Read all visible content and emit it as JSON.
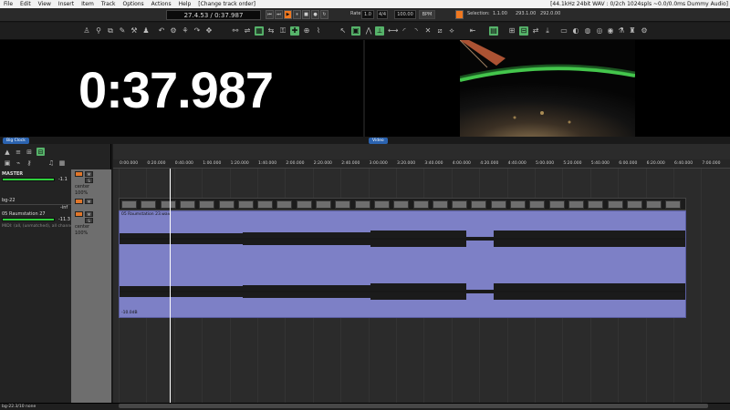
{
  "menubar": {
    "items": [
      "File",
      "Edit",
      "View",
      "Insert",
      "Item",
      "Track",
      "Options",
      "Actions",
      "Help",
      "[Change track order]"
    ],
    "status": "[44.1kHz 24bit WAV : 0/2ch 1024spls ~0.0/0.0ms Dummy Audio]"
  },
  "transport": {
    "time": "27.4.53 / 0:37.987",
    "rate_label": "Rate:",
    "rate_value": "1.0",
    "timesig": "4/4",
    "bpm_value": "100.00",
    "bpm_label": "BPM",
    "selection_label": "Selection:",
    "sel_start": "1.1.00",
    "sel_end": "293.1.00",
    "sel_len": "292.0.00"
  },
  "panels": {
    "big_clock_time": "0:37.987",
    "big_clock_tab": "Big Clock",
    "video_tab": "Video"
  },
  "tracks": {
    "master": {
      "name": "MASTER",
      "meter": "-1.1",
      "pan": "center",
      "vol": "100%"
    },
    "track1": {
      "name": "bg-22",
      "db": "-inf"
    },
    "track2": {
      "name": "05 Raumstation 27",
      "db": "-11.3",
      "input": "MIDI: (all, (unmatched), all channels)",
      "pan": "center",
      "vol": "100%"
    }
  },
  "arrange": {
    "ruler": [
      "0:00.000",
      "0:20.000",
      "0:40.000",
      "1:00.000",
      "1:20.000",
      "1:40.000",
      "2:00.000",
      "2:20.000",
      "2:40.000",
      "3:00.000",
      "3:20.000",
      "3:40.000",
      "4:00.000",
      "4:20.000",
      "4:40.000",
      "5:00.000",
      "5:20.000",
      "5:40.000",
      "6:00.000",
      "6:20.000",
      "6:40.000",
      "7:00.000"
    ],
    "audio_item_name": "05 Raumstation 23.wav",
    "audio_item_vol": "-10.0dB"
  },
  "statusbar": {
    "text": "bg-22.3/10 none"
  },
  "colors": {
    "accent_orange": "#f07820",
    "meter_green": "#2fd13d",
    "item_purple": "#7d80c6",
    "tab_blue": "#2b63b0"
  }
}
